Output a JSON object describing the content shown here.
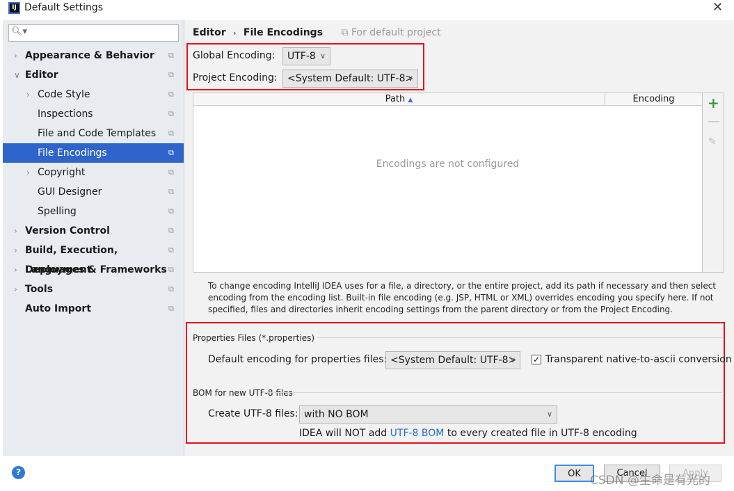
{
  "window": {
    "title": "Default Settings",
    "logo": "IJ"
  },
  "search": {
    "placeholder": ""
  },
  "sidebar": {
    "items": [
      {
        "label": "Appearance & Behavior",
        "level": 0,
        "expanded": false,
        "bold": true
      },
      {
        "label": "Editor",
        "level": 0,
        "expanded": true,
        "bold": true
      },
      {
        "label": "Code Style",
        "level": 1,
        "expanded": false
      },
      {
        "label": "Inspections",
        "level": 1
      },
      {
        "label": "File and Code Templates",
        "level": 1
      },
      {
        "label": "File Encodings",
        "level": 1,
        "selected": true
      },
      {
        "label": "Copyright",
        "level": 1,
        "expanded": false
      },
      {
        "label": "GUI Designer",
        "level": 1
      },
      {
        "label": "Spelling",
        "level": 1
      },
      {
        "label": "Version Control",
        "level": 0,
        "expanded": false,
        "bold": true
      },
      {
        "label": "Build, Execution, Deployment",
        "level": 0,
        "expanded": false,
        "bold": true
      },
      {
        "label": "Languages & Frameworks",
        "level": 0,
        "expanded": false,
        "bold": true
      },
      {
        "label": "Tools",
        "level": 0,
        "expanded": false,
        "bold": true
      },
      {
        "label": "Auto Import",
        "level": 0,
        "bold": true
      }
    ]
  },
  "breadcrumb": {
    "parent": "Editor",
    "current": "File Encodings",
    "scope": "For default project"
  },
  "encoding": {
    "global_label": "Global Encoding:",
    "global_value": "UTF-8",
    "project_label": "Project Encoding:",
    "project_value": "<System Default: UTF-8>"
  },
  "table": {
    "columns": [
      "Path",
      "Encoding"
    ],
    "sort": "Path ascending",
    "empty_text": "Encodings are not configured"
  },
  "help_text": "To change encoding IntelliJ IDEA uses for a file, a directory, or the entire project, add its path if necessary and then select encoding from the encoding list. Built-in file encoding (e.g. JSP, HTML or XML) overrides encoding you specify here. If not specified, files and directories inherit encoding settings from the parent directory or from the Project Encoding.",
  "properties": {
    "group": "Properties Files (*.properties)",
    "label": "Default encoding for properties files:",
    "value": "<System Default: UTF-8>",
    "checkbox_label": "Transparent native-to-ascii conversion",
    "checked": true
  },
  "bom": {
    "group": "BOM for new UTF-8 files",
    "label": "Create UTF-8 files:",
    "value": "with NO BOM",
    "note_pre": "IDEA will NOT add ",
    "note_link": "UTF-8 BOM",
    "note_post": " to every created file in UTF-8 encoding"
  },
  "buttons": {
    "ok": "OK",
    "cancel": "Cancel",
    "apply": "Apply"
  },
  "watermark": "CSDN @生命是有光的",
  "colors": {
    "selection": "#2f65ca",
    "highlight_box": "#e8101a",
    "link": "#2470c9",
    "add": "#3a9a3a"
  }
}
